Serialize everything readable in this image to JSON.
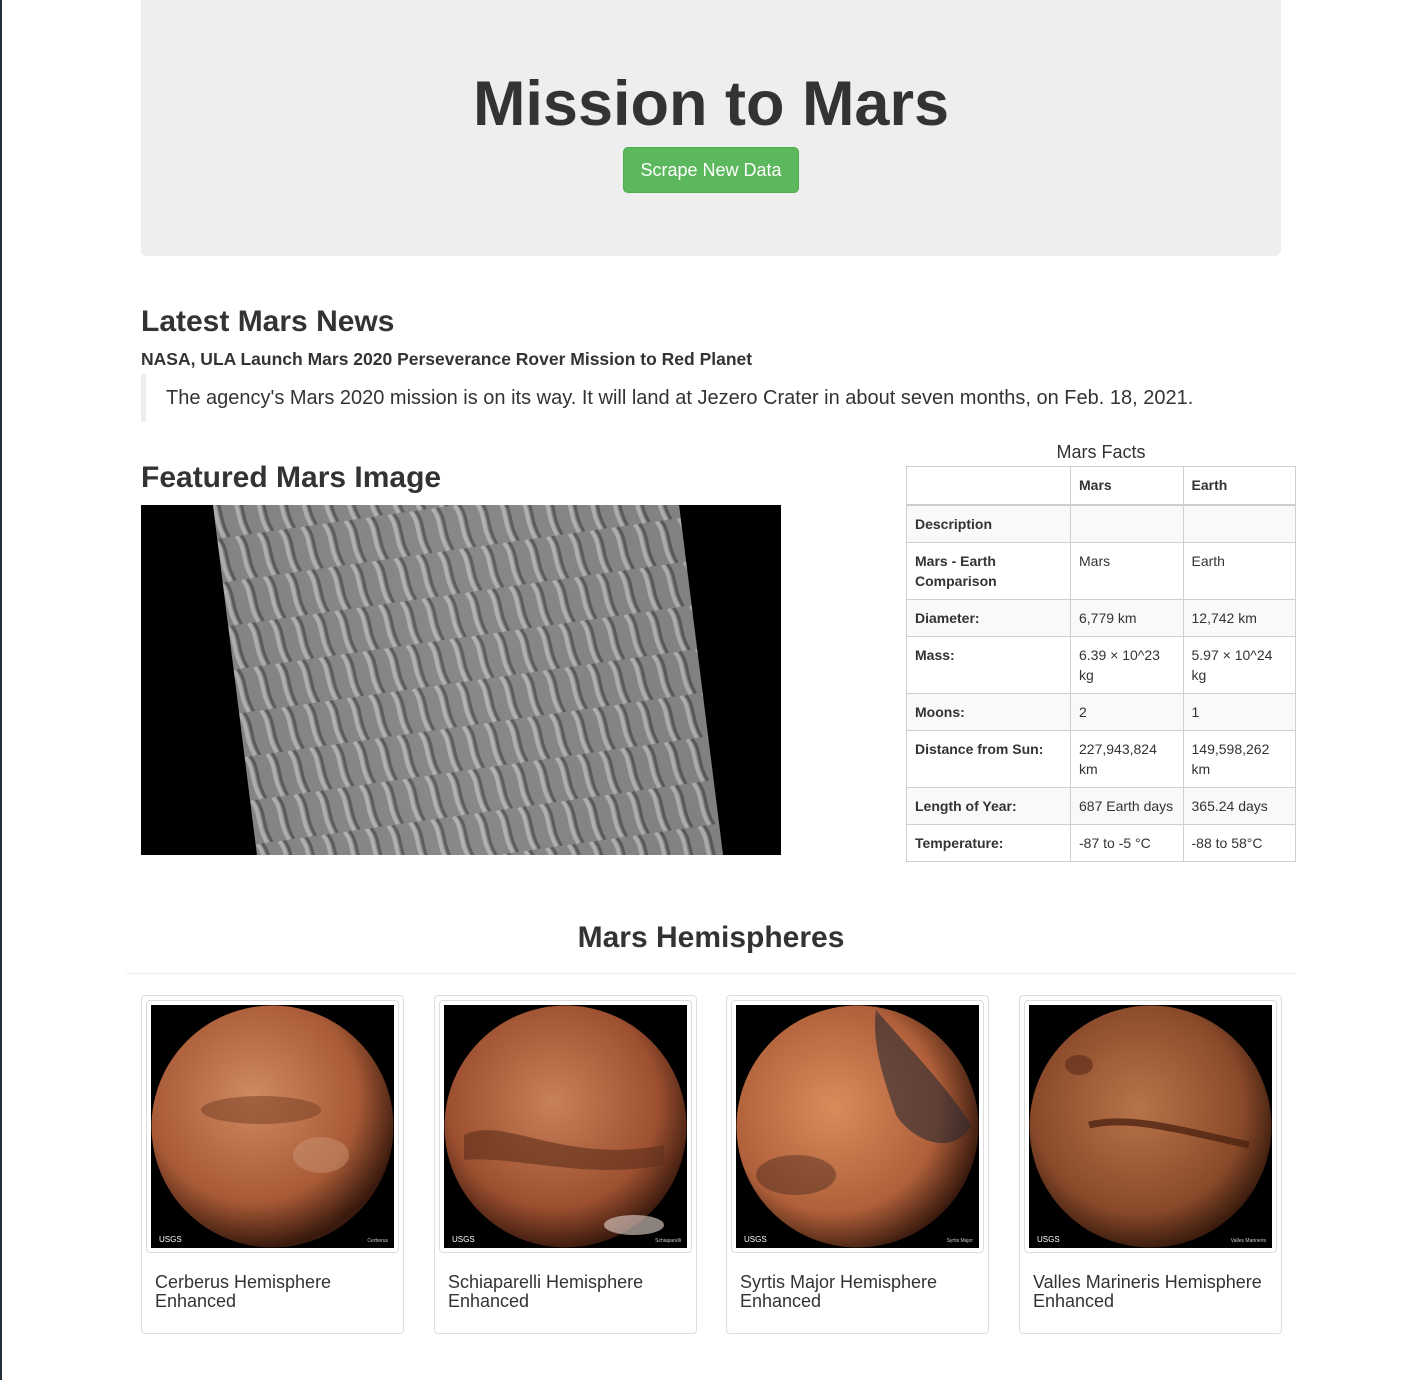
{
  "header": {
    "title": "Mission to Mars",
    "scrape_button": "Scrape New Data"
  },
  "news": {
    "heading": "Latest Mars News",
    "title": "NASA, ULA Launch Mars 2020 Perseverance Rover Mission to Red Planet",
    "paragraph": "The agency's Mars 2020 mission is on its way. It will land at Jezero Crater in about seven months, on Feb. 18, 2021."
  },
  "featured": {
    "heading": "Featured Mars Image"
  },
  "facts": {
    "caption": "Mars Facts",
    "columns": [
      "",
      "Mars",
      "Earth"
    ],
    "rows": [
      [
        "Description",
        "",
        ""
      ],
      [
        "Mars - Earth Comparison",
        "Mars",
        "Earth"
      ],
      [
        "Diameter:",
        "6,779 km",
        "12,742 km"
      ],
      [
        "Mass:",
        "6.39 × 10^23 kg",
        "5.97 × 10^24 kg"
      ],
      [
        "Moons:",
        "2",
        "1"
      ],
      [
        "Distance from Sun:",
        "227,943,824 km",
        "149,598,262 km"
      ],
      [
        "Length of Year:",
        "687 Earth days",
        "365.24 days"
      ],
      [
        "Temperature:",
        "-87 to -5 °C",
        "-88 to 58°C"
      ]
    ]
  },
  "hemispheres": {
    "heading": "Mars Hemispheres",
    "items": [
      {
        "title": "Cerberus Hemisphere Enhanced",
        "image_caption": "Cerberus"
      },
      {
        "title": "Schiaparelli Hemisphere Enhanced",
        "image_caption": "Schiaparelli"
      },
      {
        "title": "Syrtis Major Hemisphere Enhanced",
        "image_caption": "Syrtis Major"
      },
      {
        "title": "Valles Marineris Hemisphere Enhanced",
        "image_caption": "Valles Marineris"
      }
    ],
    "image_logo": "USGS"
  }
}
